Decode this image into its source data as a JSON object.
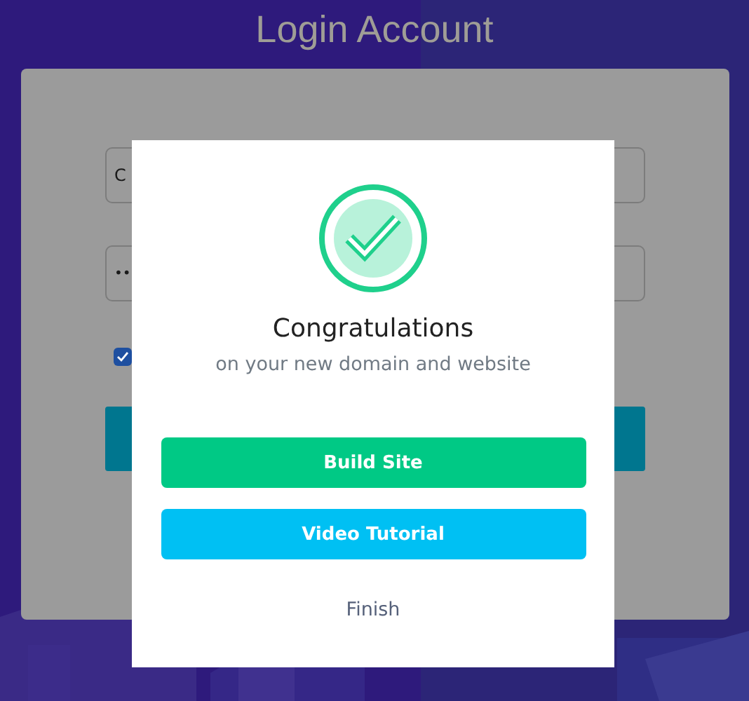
{
  "page_title": "Login Account",
  "login_form": {
    "fields": [
      {
        "kind": "text",
        "value": "C"
      },
      {
        "kind": "password",
        "value": "••"
      }
    ],
    "remember": {
      "checked": true
    }
  },
  "modal": {
    "title": "Congratulations",
    "subtitle": "on your new domain and website",
    "actions": [
      {
        "label": "Build Site",
        "kind": "primary"
      },
      {
        "label": "Video Tutorial",
        "kind": "secondary"
      },
      {
        "label": "Finish",
        "kind": "link"
      }
    ]
  }
}
